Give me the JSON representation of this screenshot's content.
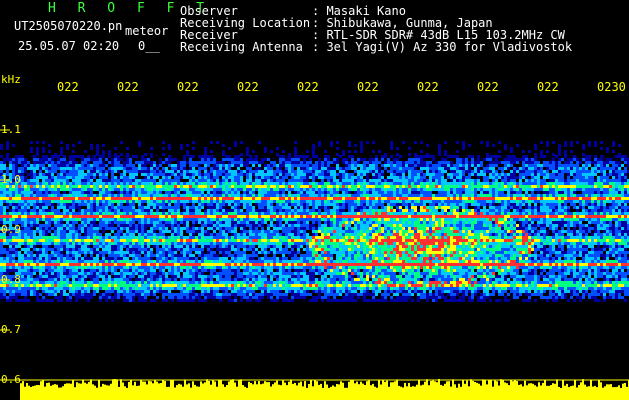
{
  "header": {
    "brand": "H R O F F T",
    "filename": "UT2505070220.pn",
    "mode": "meteor",
    "timestamp": "25.05.07 02:20",
    "index": "0__",
    "fields": [
      {
        "label": "Observer",
        "value": ": Masaki Kano"
      },
      {
        "label": "Receiving Location",
        "value": ": Shibukawa, Gunma, Japan"
      },
      {
        "label": "Receiver",
        "value": ": RTL-SDR SDR# 43dB L15 103.2MHz CW"
      },
      {
        "label": "Receiving Antenna",
        "value": ": 3el Yagi(V) Az 330 for Vladivostok"
      }
    ]
  },
  "colors": {
    "background": "#000000",
    "label": "#ffff00",
    "header_text": "#ffffff",
    "brand": "#3cff3c",
    "signal_trace": "#ffff00"
  },
  "chart_data": {
    "type": "heatmap",
    "ylabel": "kHz",
    "y_ticks": [
      "1.1",
      "1.0",
      "0.9",
      "0.8",
      "0.7",
      "0.6"
    ],
    "x_ticks": [
      "022",
      "022",
      "022",
      "022",
      "022",
      "022",
      "022",
      "022",
      "022",
      "0230"
    ],
    "y_range": [
      0.6,
      1.15
    ],
    "x_range_minutes": [
      20,
      30
    ],
    "horizontal_carriers_khz": [
      0.99,
      0.965,
      0.93,
      0.88,
      0.835,
      0.79
    ],
    "meteor_echo": {
      "center_minute": 26.8,
      "peak_khz": 0.87,
      "description": "broadband Doppler echo arc"
    },
    "colormap": [
      "#000020",
      "#0000a0",
      "#0050ff",
      "#00c8ff",
      "#00ff80",
      "#ffff00",
      "#ff3030"
    ]
  }
}
